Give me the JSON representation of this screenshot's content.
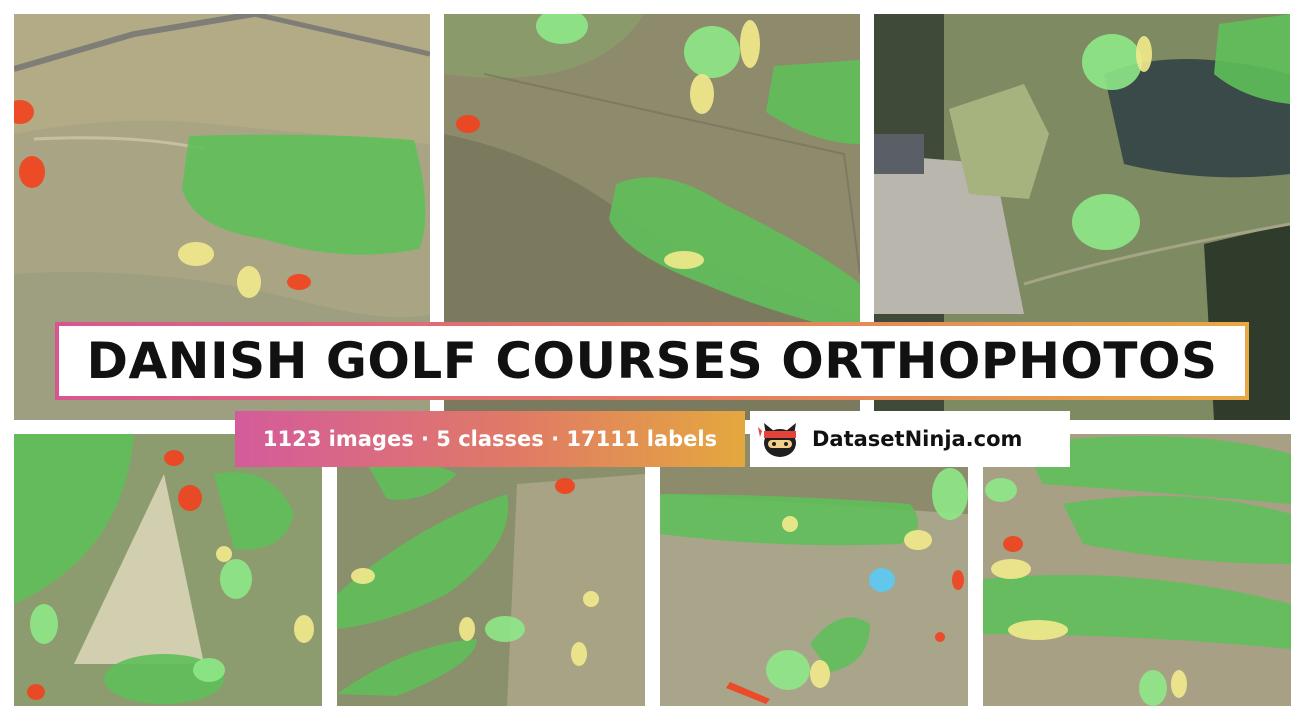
{
  "title": "DANISH GOLF COURSES ORTHOPHOTOS",
  "stats": "1123 images · 5 classes · 17111 labels",
  "brand": {
    "name": "DatasetNinja.com",
    "logo_icon": "ninja-cat-icon"
  },
  "colors": {
    "green_mask": "#5dc15d",
    "sand_mask": "#f2ea8c",
    "red_mask": "#f2411d",
    "water_mask": "#5ec8ef",
    "light_green_mask": "#8ee887",
    "gradient_start": "#d8568f",
    "gradient_end": "#e8a845"
  }
}
